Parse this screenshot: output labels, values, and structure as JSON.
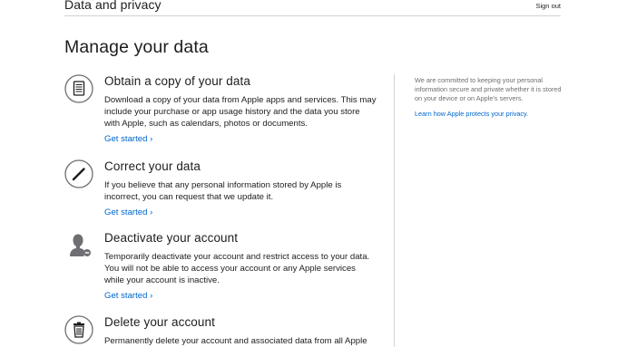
{
  "header": {
    "title": "Data and privacy",
    "signout_label": "Sign out"
  },
  "page": {
    "title": "Manage your data"
  },
  "sections": [
    {
      "title": "Obtain a copy of your data",
      "description": "Download a copy of your data from Apple apps and services. This may include your purchase or app usage history and the data you store with Apple, such as calendars, photos or documents.",
      "link": "Get started ›",
      "icon": "document-icon"
    },
    {
      "title": "Correct your data",
      "description": "If you believe that any personal information stored by Apple is incorrect, you can request that we update it.",
      "link": "Get started ›",
      "icon": "pencil-icon"
    },
    {
      "title": "Deactivate your account",
      "description": "Temporarily deactivate your account and restrict access to your data. You will not be able to access your account or any Apple services while your account is inactive.",
      "link": "Get started ›",
      "icon": "user-minus-icon"
    },
    {
      "title": "Delete your account",
      "description": "Permanently delete your account and associated data from all Apple",
      "icon": "trash-icon"
    }
  ],
  "aside": {
    "text": "We are committed to keeping your personal information secure and private whether it is stored on your device or on Apple’s servers.",
    "link": "Learn how Apple protects your privacy."
  },
  "colors": {
    "link": "#0066cc",
    "text": "#1d1d1f",
    "muted": "#6e6e73",
    "divider": "#d2d2d7"
  }
}
